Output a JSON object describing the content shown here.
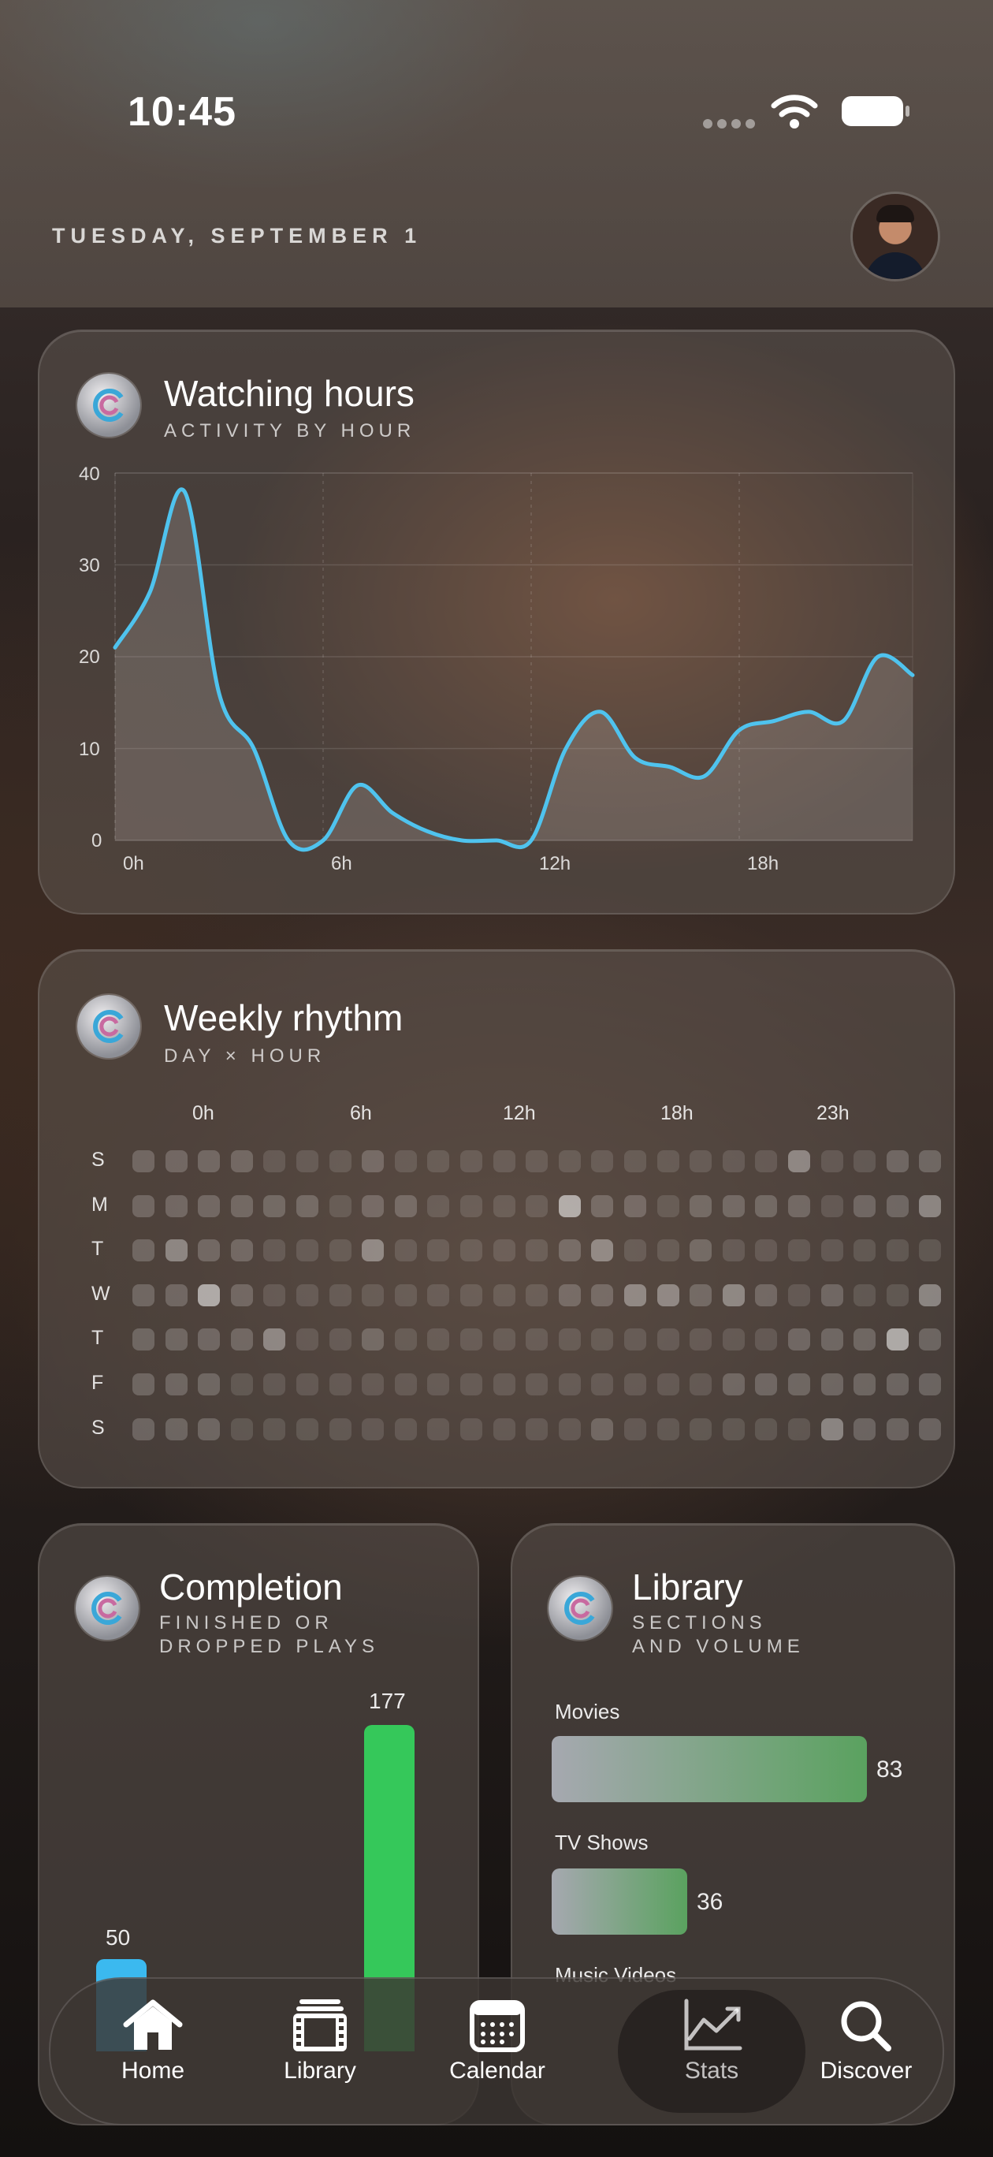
{
  "status": {
    "time": "10:45"
  },
  "header": {
    "date": "TUESDAY, SEPTEMBER 1"
  },
  "watching": {
    "title": "Watching hours",
    "subtitle": "ACTIVITY BY HOUR",
    "accent": "#4fc3ee"
  },
  "chart_data": {
    "type": "area",
    "title": "Watching hours",
    "subtitle": "ACTIVITY BY HOUR",
    "y_ticks": [
      "40",
      "30",
      "20",
      "10",
      "0"
    ],
    "x_ticks": [
      "0h",
      "6h",
      "12h",
      "18h"
    ],
    "ylim": [
      0,
      40
    ],
    "grid": true,
    "x": [
      0,
      1,
      2,
      3,
      4,
      5,
      6,
      7,
      8,
      9,
      10,
      11,
      12,
      13,
      14,
      15,
      16,
      17,
      18,
      19,
      20,
      21,
      22,
      23
    ],
    "values": [
      21,
      27,
      38,
      16,
      10,
      0,
      0,
      6,
      3,
      1,
      0,
      0,
      0,
      10,
      14,
      9,
      8,
      7,
      12,
      13,
      14,
      13,
      20,
      18
    ]
  },
  "weekly": {
    "title": "Weekly rhythm",
    "subtitle": "DAY × HOUR",
    "hour_labels": [
      "0h",
      "6h",
      "12h",
      "18h",
      "23h"
    ],
    "days": [
      "S",
      "M",
      "T",
      "W",
      "T",
      "F",
      "S"
    ],
    "grid": [
      [
        2,
        2,
        2,
        2,
        1,
        1,
        1,
        2,
        1,
        1,
        1,
        1,
        1,
        1,
        1,
        1,
        1,
        1,
        1,
        1,
        3,
        1,
        1,
        2,
        2
      ],
      [
        2,
        2,
        2,
        2,
        2,
        2,
        1,
        2,
        2,
        1,
        1,
        1,
        1,
        4,
        2,
        2,
        1,
        2,
        2,
        2,
        2,
        1,
        2,
        2,
        3
      ],
      [
        2,
        3,
        2,
        2,
        1,
        1,
        1,
        3,
        1,
        1,
        1,
        1,
        1,
        2,
        3,
        1,
        1,
        2,
        1,
        1,
        1,
        1,
        1,
        1,
        1
      ],
      [
        2,
        2,
        4,
        2,
        1,
        1,
        1,
        1,
        1,
        1,
        1,
        1,
        1,
        2,
        2,
        3,
        3,
        2,
        3,
        2,
        1,
        2,
        1,
        1,
        3
      ],
      [
        2,
        2,
        2,
        2,
        3,
        1,
        1,
        2,
        1,
        1,
        1,
        1,
        1,
        1,
        1,
        1,
        1,
        1,
        1,
        1,
        2,
        2,
        2,
        4,
        2
      ],
      [
        2,
        2,
        2,
        1,
        1,
        1,
        1,
        1,
        1,
        1,
        1,
        1,
        1,
        1,
        1,
        1,
        1,
        1,
        2,
        2,
        2,
        2,
        2,
        2,
        2
      ],
      [
        2,
        2,
        2,
        1,
        1,
        1,
        1,
        1,
        1,
        1,
        1,
        1,
        1,
        1,
        2,
        1,
        1,
        1,
        1,
        1,
        1,
        3,
        2,
        2,
        2
      ]
    ]
  },
  "completion": {
    "title": "Completion",
    "subtitle_line1": "FINISHED OR",
    "subtitle_line2": "DROPPED PLAYS",
    "finished_value": "177",
    "dropped_value": "50",
    "finished_color": "#35c85a",
    "dropped_color": "#3bb9ef"
  },
  "library": {
    "title": "Library",
    "subtitle_line1": "SECTIONS",
    "subtitle_line2": "AND VOLUME",
    "items": [
      {
        "label": "Movies",
        "value": "83"
      },
      {
        "label": "TV Shows",
        "value": "36"
      },
      {
        "label": "Music Videos",
        "value": ""
      }
    ]
  },
  "tabs": [
    {
      "label": "Home",
      "icon": "house-icon"
    },
    {
      "label": "Library",
      "icon": "film-stack-icon"
    },
    {
      "label": "Calendar",
      "icon": "calendar-icon"
    },
    {
      "label": "Stats",
      "icon": "chart-line-icon"
    },
    {
      "label": "Discover",
      "icon": "magnifier-icon"
    }
  ],
  "active_tab": "Stats"
}
